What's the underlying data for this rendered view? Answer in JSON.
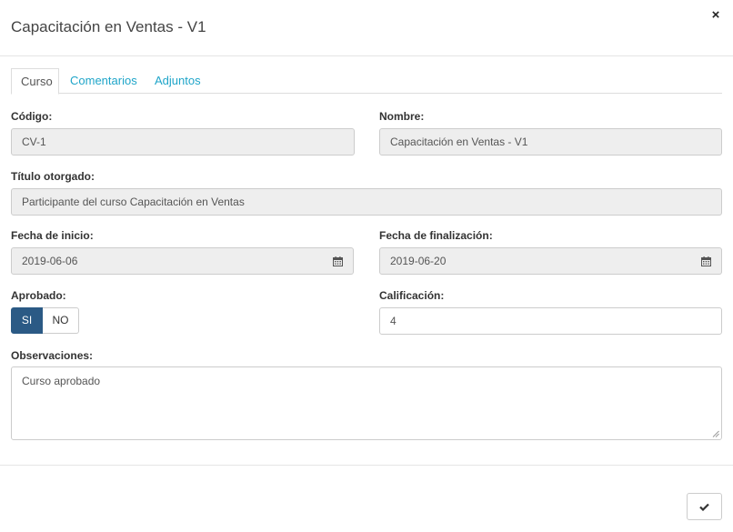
{
  "dialog": {
    "title": "Capacitación en Ventas - V1",
    "close_symbol": "×"
  },
  "tabs": [
    {
      "label": "Curso",
      "active": true
    },
    {
      "label": "Comentarios",
      "active": false
    },
    {
      "label": "Adjuntos",
      "active": false
    }
  ],
  "form": {
    "codigo": {
      "label": "Código:",
      "value": "CV-1"
    },
    "nombre": {
      "label": "Nombre:",
      "value": "Capacitación en Ventas - V1"
    },
    "titulo": {
      "label": "Título otorgado:",
      "value": "Participante del curso Capacitación en Ventas"
    },
    "fecha_inicio": {
      "label": "Fecha de inicio:",
      "value": "2019-06-06",
      "icon": "calendar-icon"
    },
    "fecha_fin": {
      "label": "Fecha de finalización:",
      "value": "2019-06-20",
      "icon": "calendar-icon"
    },
    "aprobado": {
      "label": "Aprobado:",
      "options": [
        "SI",
        "NO"
      ],
      "selected": "SI"
    },
    "calificacion": {
      "label": "Calificación:",
      "value": "4"
    },
    "observaciones": {
      "label": "Observaciones:",
      "value": "Curso aprobado"
    }
  },
  "footer": {
    "confirm_icon": "checkmark-icon"
  },
  "colors": {
    "accent": "#2b5a85",
    "link": "#1fa5c9",
    "readonly_bg": "#eeeeee"
  }
}
